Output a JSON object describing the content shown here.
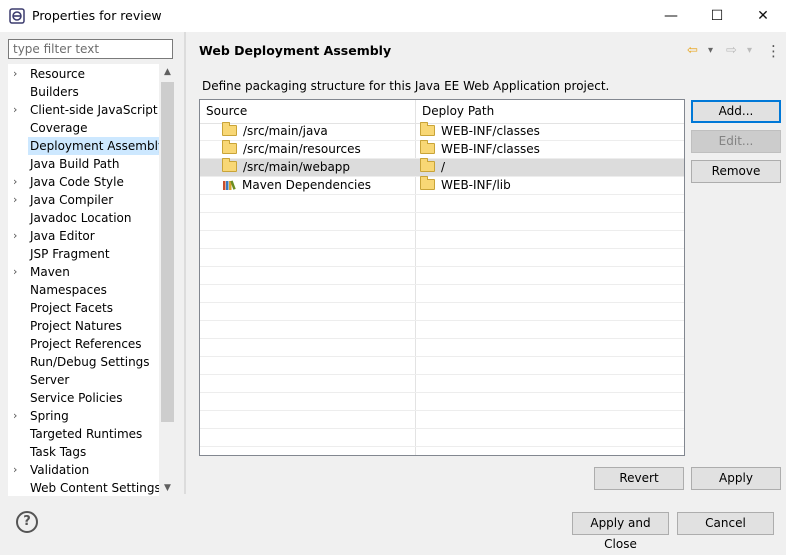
{
  "window": {
    "title": "Properties for review",
    "minimize_glyph": "—",
    "maximize_glyph": "☐",
    "close_glyph": "✕"
  },
  "filter": {
    "placeholder": "type filter text",
    "value": ""
  },
  "tree": {
    "items": [
      {
        "label": "Resource",
        "expandable": true
      },
      {
        "label": "Builders",
        "expandable": false
      },
      {
        "label": "Client-side JavaScript",
        "expandable": true
      },
      {
        "label": "Coverage",
        "expandable": false
      },
      {
        "label": "Deployment Assembly",
        "expandable": false,
        "selected": true
      },
      {
        "label": "Java Build Path",
        "expandable": false
      },
      {
        "label": "Java Code Style",
        "expandable": true
      },
      {
        "label": "Java Compiler",
        "expandable": true
      },
      {
        "label": "Javadoc Location",
        "expandable": false
      },
      {
        "label": "Java Editor",
        "expandable": true
      },
      {
        "label": "JSP Fragment",
        "expandable": false
      },
      {
        "label": "Maven",
        "expandable": true
      },
      {
        "label": "Namespaces",
        "expandable": false
      },
      {
        "label": "Project Facets",
        "expandable": false
      },
      {
        "label": "Project Natures",
        "expandable": false
      },
      {
        "label": "Project References",
        "expandable": false
      },
      {
        "label": "Run/Debug Settings",
        "expandable": false
      },
      {
        "label": "Server",
        "expandable": false
      },
      {
        "label": "Service Policies",
        "expandable": false
      },
      {
        "label": "Spring",
        "expandable": true
      },
      {
        "label": "Targeted Runtimes",
        "expandable": false
      },
      {
        "label": "Task Tags",
        "expandable": false
      },
      {
        "label": "Validation",
        "expandable": true
      },
      {
        "label": "Web Content Settings",
        "expandable": false
      }
    ],
    "expand_glyph": "›"
  },
  "page": {
    "title": "Web Deployment Assembly",
    "description": "Define packaging structure for this Java EE Web Application project."
  },
  "nav": {
    "back_glyph": "⇦",
    "forward_glyph": "⇨",
    "dropdown_glyph": "▾",
    "menu_glyph": "⋮"
  },
  "table": {
    "columns": [
      "Source",
      "Deploy Path"
    ],
    "rows": [
      {
        "source": "/src/main/java",
        "path": "WEB-INF/classes",
        "source_icon": "folder-icon"
      },
      {
        "source": "/src/main/resources",
        "path": "WEB-INF/classes",
        "source_icon": "folder-icon"
      },
      {
        "source": "/src/main/webapp",
        "path": "/",
        "source_icon": "folder-icon",
        "selected": true
      },
      {
        "source": "Maven Dependencies",
        "path": "WEB-INF/lib",
        "source_icon": "library-icon"
      }
    ],
    "empty_rows": 15
  },
  "buttons": {
    "add": "Add...",
    "edit": "Edit...",
    "remove": "Remove",
    "revert": "Revert",
    "apply": "Apply",
    "apply_close": "Apply and Close",
    "cancel": "Cancel",
    "help": "?"
  }
}
